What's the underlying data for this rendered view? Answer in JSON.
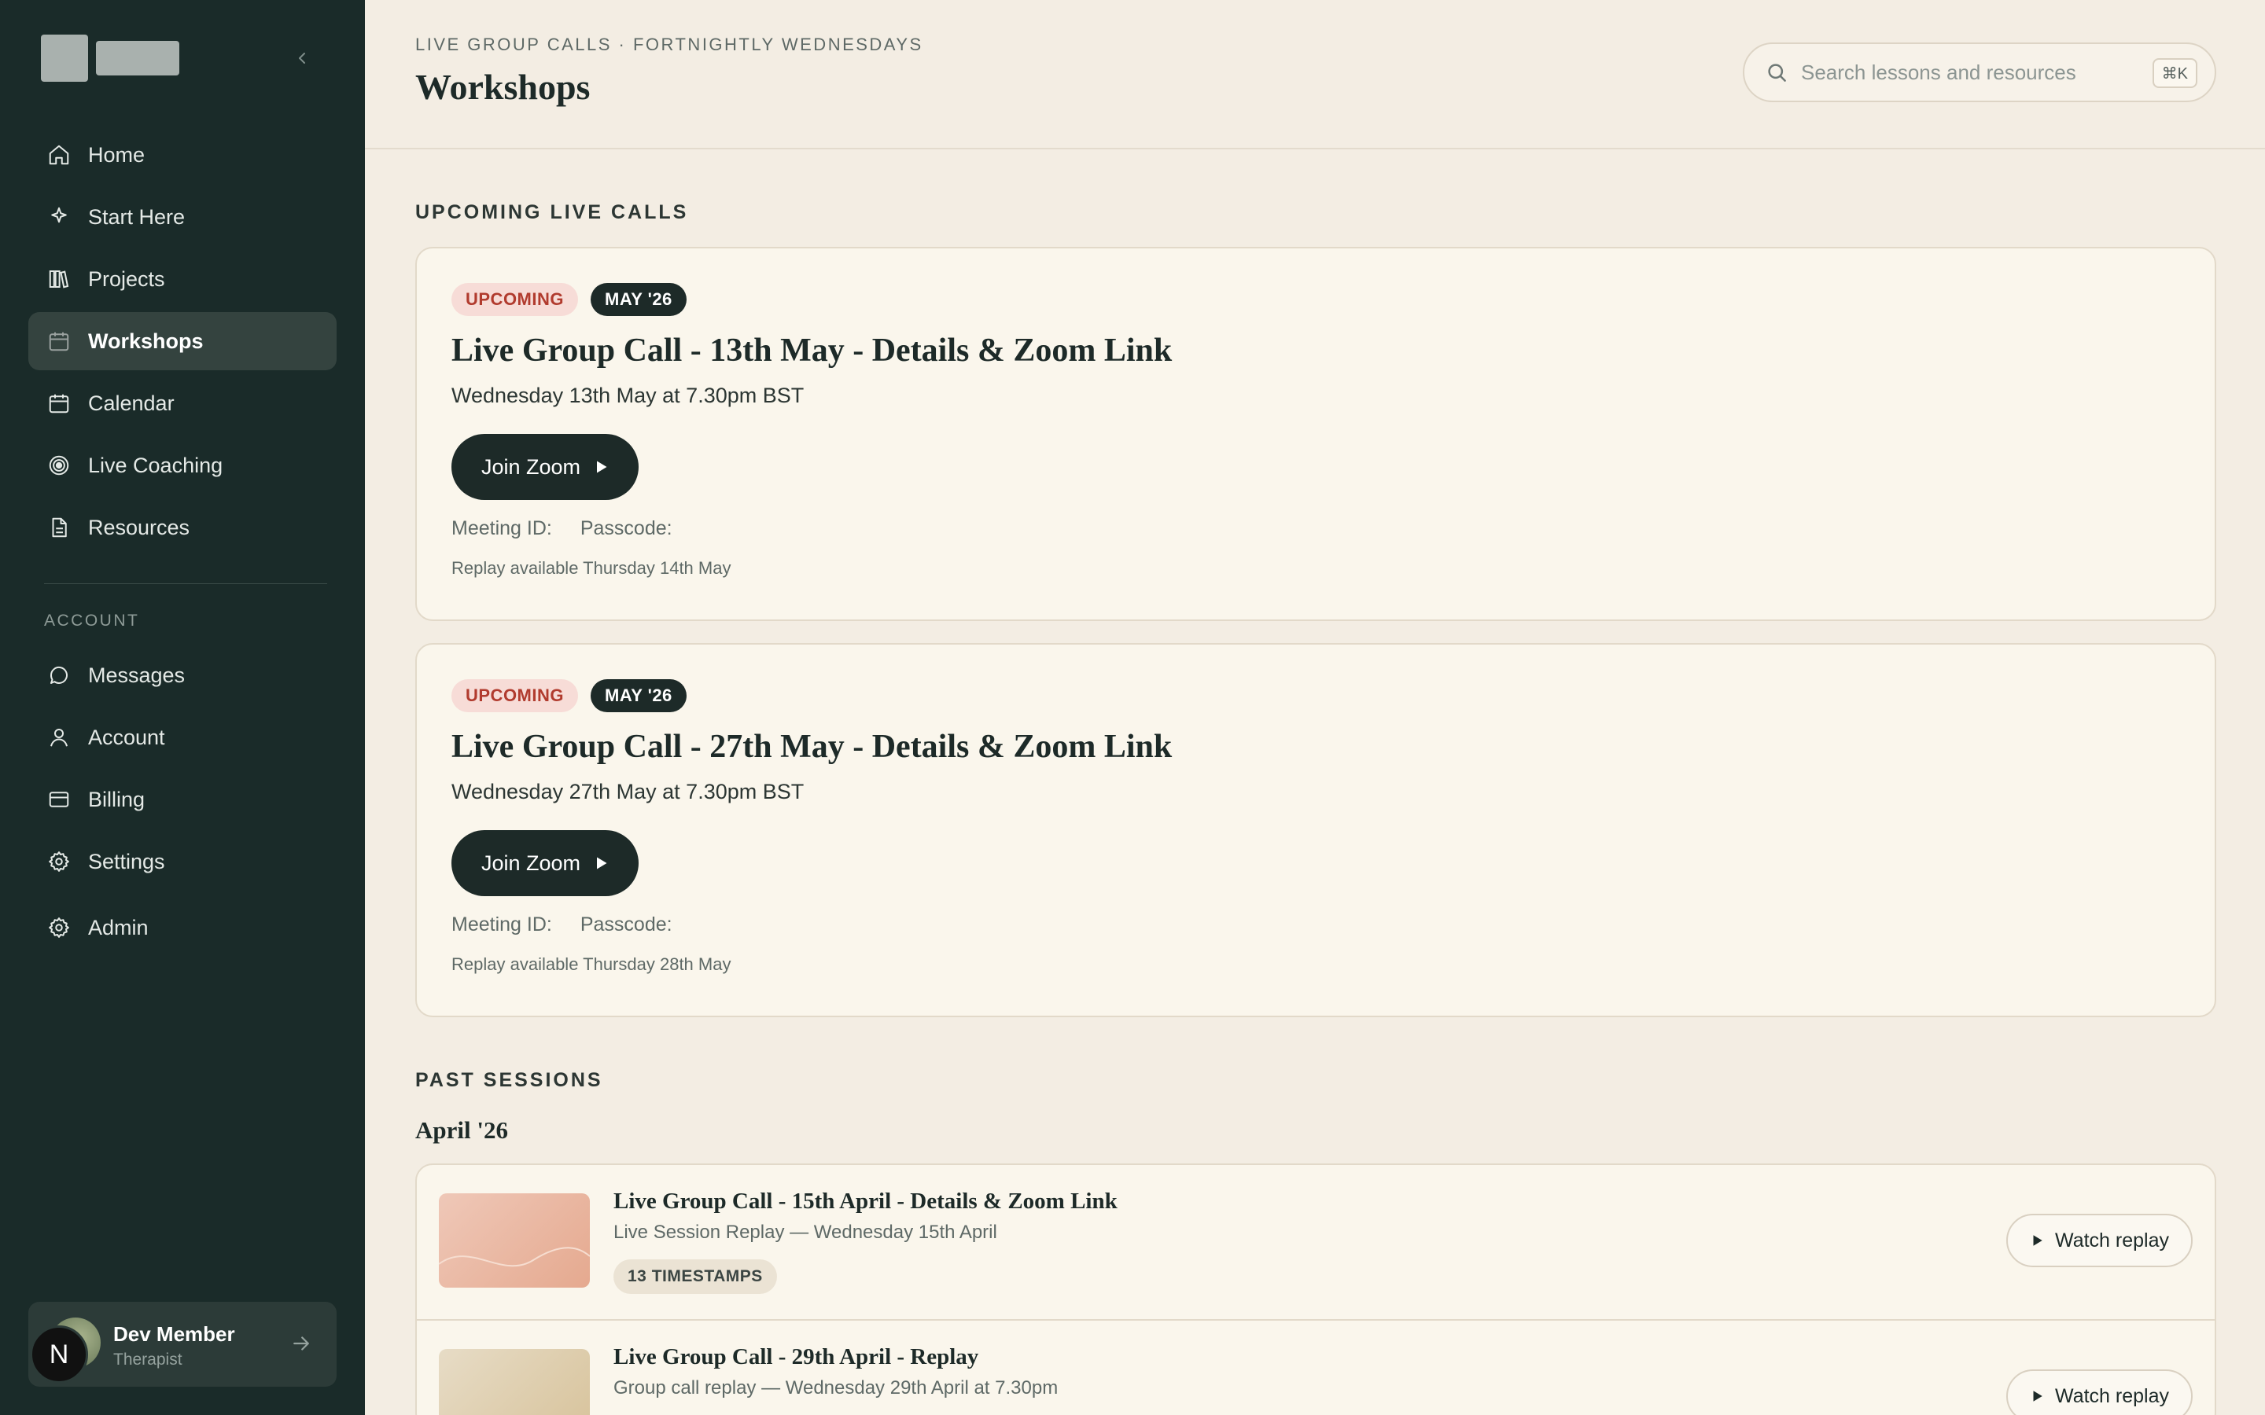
{
  "sidebar": {
    "nav": [
      {
        "label": "Home",
        "icon": "home-icon"
      },
      {
        "label": "Start Here",
        "icon": "sparkle-icon"
      },
      {
        "label": "Projects",
        "icon": "library-icon"
      },
      {
        "label": "Workshops",
        "icon": "calendar-icon",
        "active": true
      },
      {
        "label": "Calendar",
        "icon": "calendar-icon"
      },
      {
        "label": "Live Coaching",
        "icon": "broadcast-icon"
      },
      {
        "label": "Resources",
        "icon": "document-icon"
      }
    ],
    "account_label": "ACCOUNT",
    "account_nav": [
      {
        "label": "Messages",
        "icon": "chat-bubble-icon"
      },
      {
        "label": "Account",
        "icon": "user-icon"
      },
      {
        "label": "Billing",
        "icon": "credit-card-icon"
      },
      {
        "label": "Settings",
        "icon": "gear-icon"
      },
      {
        "label": "Admin",
        "icon": "gear-icon"
      }
    ],
    "user": {
      "name": "Dev Member",
      "role": "Therapist",
      "badge_letter": "N"
    }
  },
  "header": {
    "eyebrow": "LIVE GROUP CALLS · FORTNIGHTLY WEDNESDAYS",
    "title": "Workshops",
    "search": {
      "placeholder": "Search lessons and resources",
      "value": "",
      "shortcut": "⌘K"
    }
  },
  "upcoming": {
    "heading": "UPCOMING LIVE CALLS",
    "calls": [
      {
        "status": "UPCOMING",
        "month": "MAY '26",
        "title": "Live Group Call - 13th May - Details & Zoom Link",
        "date": "Wednesday 13th May at 7.30pm BST",
        "join_label": "Join Zoom",
        "meeting_id_label": "Meeting ID:",
        "passcode_label": "Passcode:",
        "replay_note": "Replay available Thursday 14th May"
      },
      {
        "status": "UPCOMING",
        "month": "MAY '26",
        "title": "Live Group Call - 27th May - Details & Zoom Link",
        "date": "Wednesday 27th May at 7.30pm BST",
        "join_label": "Join Zoom",
        "meeting_id_label": "Meeting ID:",
        "passcode_label": "Passcode:",
        "replay_note": "Replay available Thursday 28th May"
      }
    ]
  },
  "past": {
    "heading": "PAST SESSIONS",
    "month": "April '26",
    "sessions": [
      {
        "title": "Live Group Call - 15th April - Details & Zoom Link",
        "subtitle": "Live Session Replay — Wednesday 15th April",
        "tag": "13 TIMESTAMPS",
        "watch_label": "Watch replay"
      },
      {
        "title": "Live Group Call - 29th April - Replay",
        "subtitle": "Group call replay — Wednesday 29th April at 7.30pm",
        "tag": "",
        "watch_label": "Watch replay"
      }
    ]
  },
  "colors": {
    "sidebar_bg": "#1a2b29",
    "page_bg": "#f3ede3",
    "card_bg": "#faf6ec",
    "accent_dark": "#1d2a28",
    "upcoming_badge": "#f7dcd7",
    "upcoming_text": "#b13b2e"
  }
}
